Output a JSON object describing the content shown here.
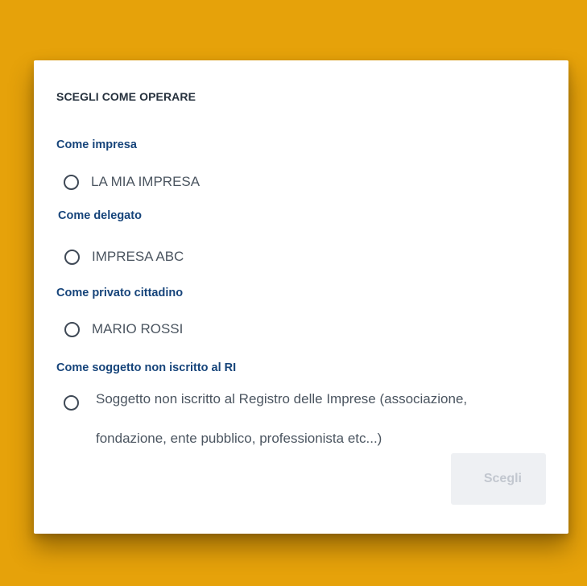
{
  "dialog": {
    "title": "SCEGLI COME OPERARE"
  },
  "sections": [
    {
      "title": "Come impresa",
      "option": "LA MIA IMPRESA"
    },
    {
      "title": "Come delegato",
      "option": "IMPRESA ABC"
    },
    {
      "title": "Come privato cittadino",
      "option": "MARIO ROSSI"
    },
    {
      "title": "Come soggetto non iscritto al RI",
      "option_line1": "Soggetto non iscritto al Registro delle Imprese (associazione,",
      "option_line2": "fondazione, ente pubblico, professionista etc...)"
    }
  ],
  "actions": {
    "choose_label": "Scegli",
    "choose_state": "disabled"
  },
  "colors": {
    "background": "#e6a20a",
    "section_title": "#16447a",
    "dialog_title": "#26313d",
    "option_text": "#4b5560",
    "button_disabled_bg": "#eef0f3",
    "button_disabled_text": "#c2c7cf"
  }
}
